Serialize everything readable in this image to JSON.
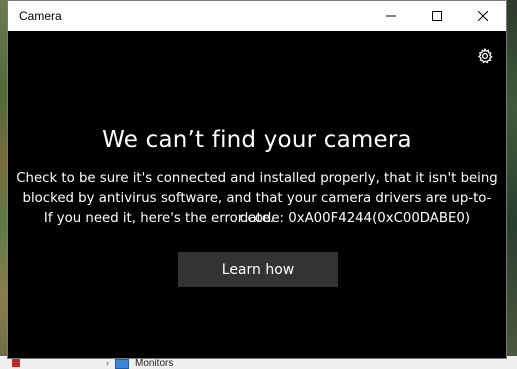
{
  "window": {
    "title": "Camera",
    "minimize_icon": "minimize-icon",
    "maximize_icon": "maximize-icon",
    "close_icon": "close-icon"
  },
  "content": {
    "settings_icon": "gear-icon",
    "heading": "We can’t find your camera",
    "message_lines": [
      "Check to be sure it's connected and installed properly, that it isn't being",
      "blocked by antivirus software, and that your camera drivers are up-to-date.",
      "If you need it, here's the error code: 0xA00F4244(0xC00DABE0)"
    ],
    "button_label": "Learn how"
  },
  "background": {
    "explorer_item": "Monitors"
  }
}
